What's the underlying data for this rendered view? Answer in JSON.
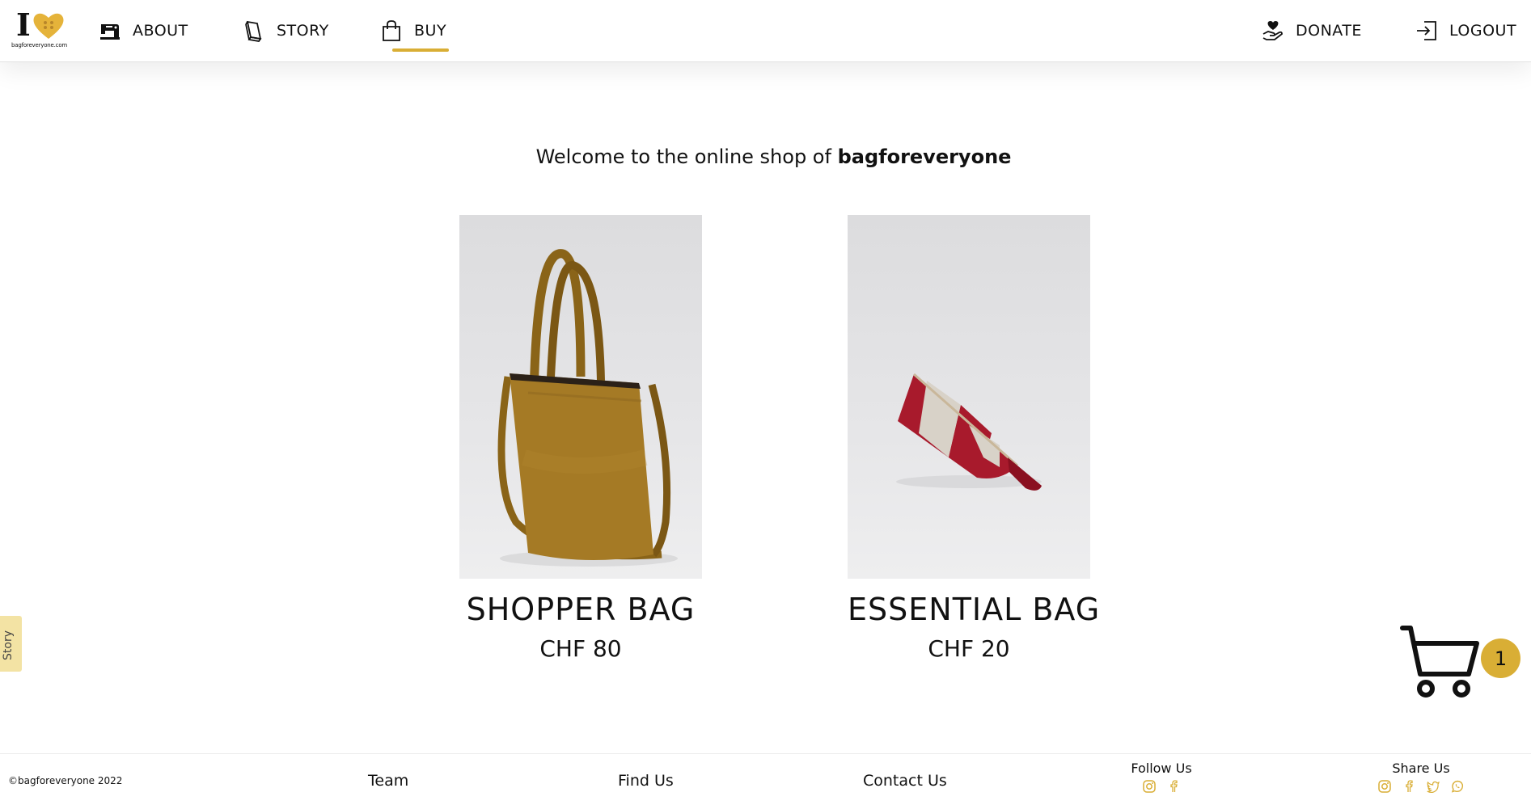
{
  "header": {
    "logo": {
      "mark": "I",
      "text": "bagforeveryone.com",
      "heart_color": "#e5b33a"
    },
    "nav": [
      {
        "label": "ABOUT",
        "icon": "sewing-machine-icon"
      },
      {
        "label": "STORY",
        "icon": "book-icon"
      },
      {
        "label": "BUY",
        "icon": "shopping-bag-icon",
        "active": true
      },
      {
        "label": "DONATE",
        "icon": "donate-hand-heart-icon"
      },
      {
        "label": "LOGOUT",
        "icon": "logout-icon"
      }
    ]
  },
  "main": {
    "welcome_prefix": "Welcome to the online shop of ",
    "welcome_brand": "bagforeveryone",
    "products": [
      {
        "name": "SHOPPER BAG",
        "price": "CHF 80"
      },
      {
        "name": "ESSENTIAL BAG",
        "price": "CHF 20"
      }
    ]
  },
  "story_tab": {
    "label": "Story"
  },
  "cart": {
    "count": "1",
    "icon": "shopping-cart-icon"
  },
  "footer": {
    "copyright": "©bagforeveryone 2022",
    "links": [
      "Team",
      "Find Us",
      "Contact Us"
    ],
    "follow": {
      "title": "Follow Us",
      "icons": [
        "instagram-icon",
        "facebook-icon"
      ]
    },
    "share": {
      "title": "Share Us",
      "icons": [
        "instagram-icon",
        "facebook-icon",
        "twitter-icon",
        "whatsapp-icon"
      ]
    }
  },
  "colors": {
    "accent": "#d9ae35",
    "story_tab": "#f3e3a4"
  }
}
